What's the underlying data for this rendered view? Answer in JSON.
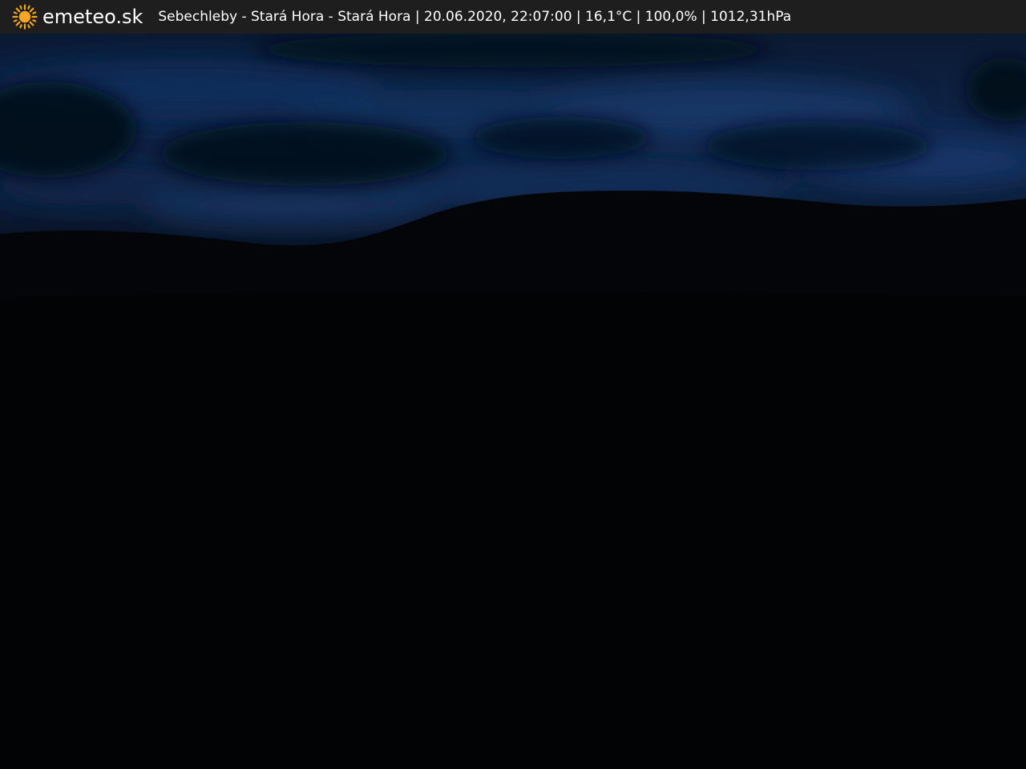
{
  "header": {
    "brand": "emeteo.sk",
    "caption": "Sebechleby - Stará Hora - Stará Hora | 20.06.2020, 22:07:00 | 16,1°C | 100,0% | 1012,31hPa",
    "logo_icon": "sun-icon"
  },
  "colors": {
    "bar": "#1e1e1e",
    "sun": "#f5a623",
    "sky": "#0e2344",
    "ground": "#020304"
  }
}
